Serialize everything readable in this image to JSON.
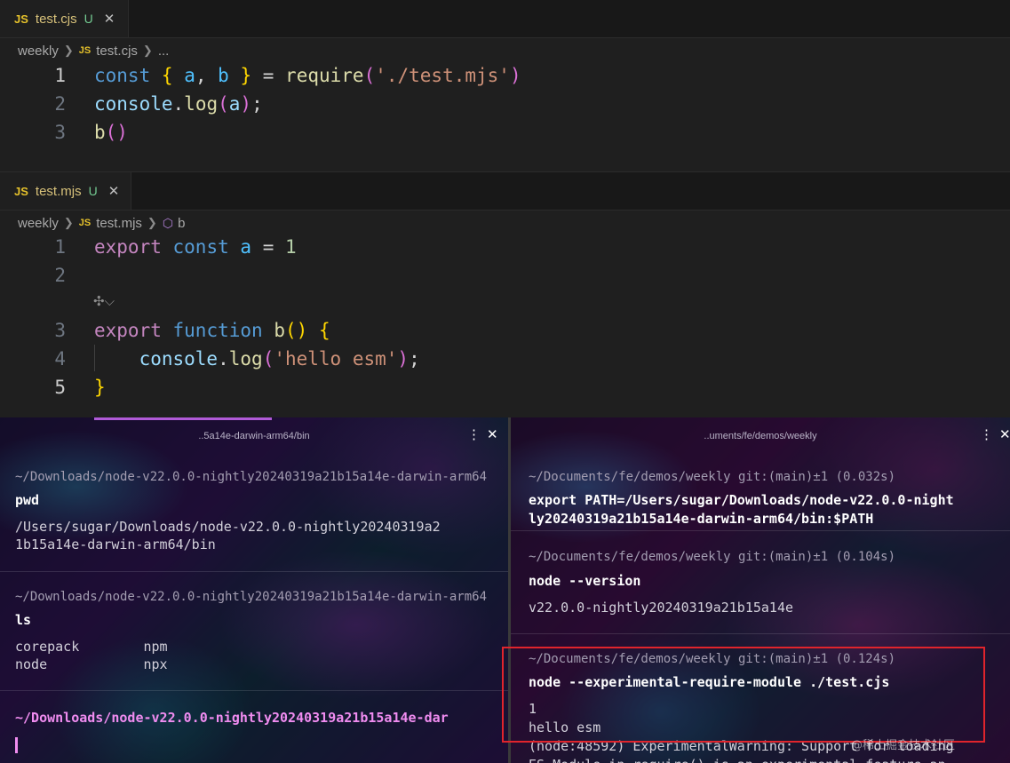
{
  "editor1": {
    "tab": {
      "badge": "JS",
      "name": "test.cjs",
      "status": "U",
      "close": "✕"
    },
    "crumbs": {
      "folder": "weekly",
      "badge": "JS",
      "file": "test.cjs",
      "tail": "..."
    },
    "lines": [
      {
        "n": "1",
        "tokens": [
          [
            "kw",
            "const"
          ],
          [
            "pn",
            " "
          ],
          [
            "brace",
            "{"
          ],
          [
            "pn",
            " "
          ],
          [
            "var",
            "a"
          ],
          [
            "pn",
            ", "
          ],
          [
            "var",
            "b"
          ],
          [
            "pn",
            " "
          ],
          [
            "brace",
            "}"
          ],
          [
            "pn",
            " = "
          ],
          [
            "fn",
            "require"
          ],
          [
            "paren",
            "("
          ],
          [
            "str",
            "'./test.mjs'"
          ],
          [
            "paren",
            ")"
          ]
        ]
      },
      {
        "n": "2",
        "tokens": [
          [
            "prop",
            "console"
          ],
          [
            "pn",
            "."
          ],
          [
            "fn",
            "log"
          ],
          [
            "paren",
            "("
          ],
          [
            "prop",
            "a"
          ],
          [
            "paren",
            ")"
          ],
          [
            "pn",
            ";"
          ]
        ]
      },
      {
        "n": "3",
        "tokens": [
          [
            "fn",
            "b"
          ],
          [
            "paren",
            "()"
          ]
        ]
      }
    ]
  },
  "editor2": {
    "tab": {
      "badge": "JS",
      "name": "test.mjs",
      "status": "U",
      "close": "✕"
    },
    "crumbs": {
      "folder": "weekly",
      "badge": "JS",
      "file": "test.mjs",
      "symbol": "b"
    },
    "lines": [
      {
        "n": "1",
        "tokens": [
          [
            "kw2",
            "export"
          ],
          [
            "pn",
            " "
          ],
          [
            "kw",
            "const"
          ],
          [
            "pn",
            " "
          ],
          [
            "var",
            "a"
          ],
          [
            "pn",
            " = "
          ],
          [
            "num",
            "1"
          ]
        ]
      },
      {
        "n": "2",
        "tokens": []
      },
      {
        "n": "3",
        "tokens": [
          [
            "kw2",
            "export"
          ],
          [
            "pn",
            " "
          ],
          [
            "kw",
            "function"
          ],
          [
            "pn",
            " "
          ],
          [
            "fn",
            "b"
          ],
          [
            "brace",
            "()"
          ],
          [
            "pn",
            " "
          ],
          [
            "brace",
            "{"
          ]
        ]
      },
      {
        "n": "4",
        "tokens": [
          [
            "pn",
            "    "
          ],
          [
            "prop",
            "console"
          ],
          [
            "pn",
            "."
          ],
          [
            "fn",
            "log"
          ],
          [
            "paren",
            "("
          ],
          [
            "str",
            "'hello esm'"
          ],
          [
            "paren",
            ")"
          ],
          [
            "pn",
            ";"
          ]
        ]
      },
      {
        "n": "5",
        "tokens": [
          [
            "brace",
            "}"
          ]
        ]
      }
    ]
  },
  "terminal_left": {
    "title": "..5a14e-darwin-arm64/bin",
    "blocks": [
      {
        "cwd": "~/Downloads/node-v22.0.0-nightly20240319a21b15a14e-darwin-arm64",
        "cmd": "pwd",
        "out": [
          "/Users/sugar/Downloads/node-v22.0.0-nightly20240319a2",
          "1b15a14e-darwin-arm64/bin"
        ]
      },
      {
        "cwd": "~/Downloads/node-v22.0.0-nightly20240319a21b15a14e-darwin-arm64",
        "cmd": "ls",
        "out": [
          "corepack        npm",
          "node            npx"
        ]
      }
    ],
    "prompt": "~/Downloads/node-v22.0.0-nightly20240319a21b15a14e-dar"
  },
  "terminal_right": {
    "title": "..uments/fe/demos/weekly",
    "blocks": [
      {
        "cwd": "~/Documents/fe/demos/weekly git:(main)±1 (0.032s)",
        "cmd": [
          "export PATH=/Users/sugar/Downloads/node-v22.0.0-night",
          "ly20240319a21b15a14e-darwin-arm64/bin:$PATH"
        ]
      },
      {
        "cwd": "~/Documents/fe/demos/weekly git:(main)±1 (0.104s)",
        "cmd": [
          "node --version"
        ],
        "out": [
          "v22.0.0-nightly20240319a21b15a14e"
        ]
      },
      {
        "cwd": "~/Documents/fe/demos/weekly git:(main)±1 (0.124s)",
        "cmd": [
          "node --experimental-require-module ./test.cjs"
        ],
        "out": [
          "1",
          "hello esm",
          "(node:48592) ExperimentalWarning: Support for loading",
          "ES Module in require() is an experimental feature an"
        ]
      }
    ]
  },
  "watermark": "@稀土掘金技术社区",
  "colors": {
    "highlight_box": "#e0242c",
    "prompt": "#f08cf0"
  }
}
